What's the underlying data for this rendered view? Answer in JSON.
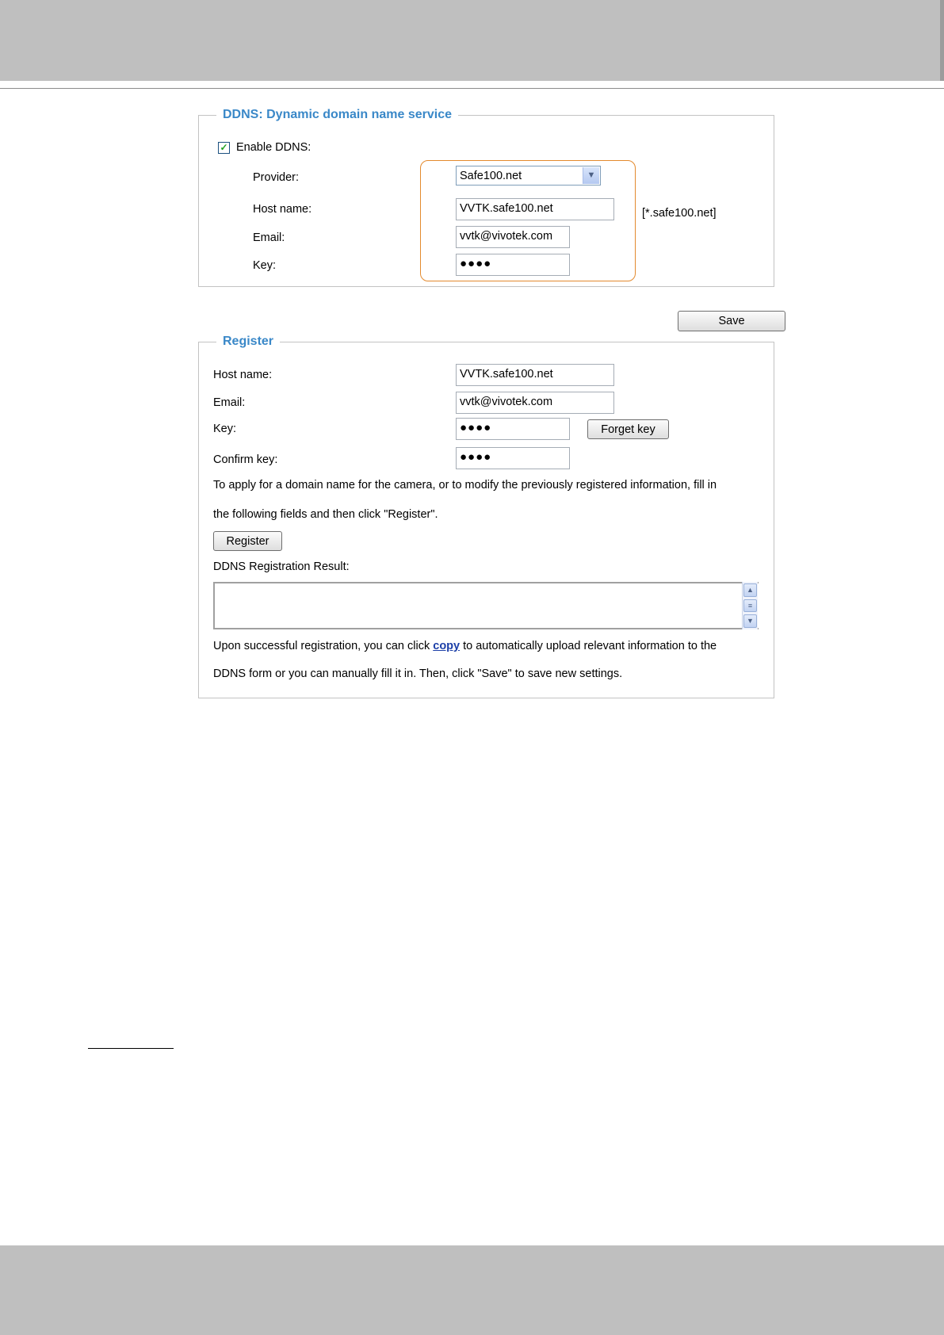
{
  "ddns": {
    "title": "DDNS: Dynamic domain name service",
    "enable_label": "Enable DDNS:",
    "enable_checked": true,
    "provider_label": "Provider:",
    "provider_value": "Safe100.net",
    "hostname_label": "Host name:",
    "hostname_value": "VVTK.safe100.net",
    "hostname_suffix": "[*.safe100.net]",
    "email_label": "Email:",
    "email_value": "vvtk@vivotek.com",
    "key_label": "Key:",
    "key_value": "●●●●"
  },
  "save_button": "Save",
  "register": {
    "title": "Register",
    "hostname_label": "Host name:",
    "hostname_value": "VVTK.safe100.net",
    "email_label": "Email:",
    "email_value": "vvtk@vivotek.com",
    "key_label": "Key:",
    "key_value": "●●●●",
    "forget_key_button": "Forget key",
    "confirm_key_label": "Confirm key:",
    "confirm_key_value": "●●●●",
    "instructions_line1": "To apply for a domain name for the camera, or to modify the previously registered information, fill in",
    "instructions_line2": "the following fields and then click \"Register\".",
    "register_button": "Register",
    "result_label": "DDNS Registration Result:",
    "result_value": "",
    "note_part1": "Upon successful registration, you can click ",
    "copy_link": "copy",
    "note_part2": " to automatically upload relevant information to the",
    "note_line2": "DDNS form or you can manually fill it in. Then, click \"Save\" to save new settings."
  },
  "colors": {
    "header_band": "#bfbfbf",
    "group_title": "#3a88c8",
    "highlight_border": "#e38a2e",
    "link": "#1c3fa8"
  }
}
